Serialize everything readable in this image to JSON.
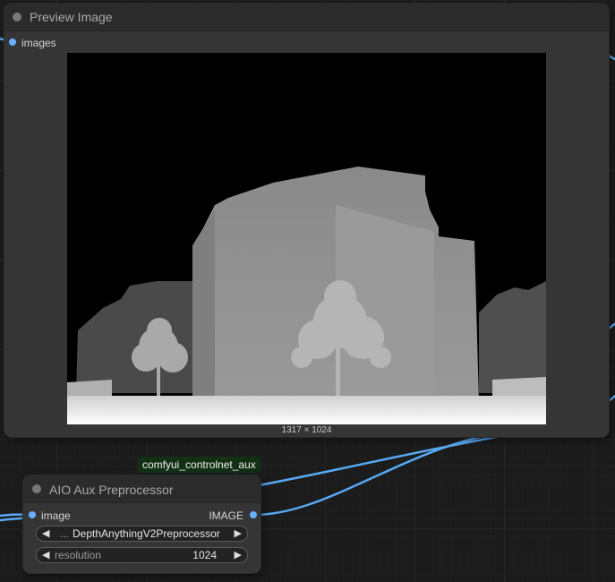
{
  "preview_node": {
    "title": "Preview Image",
    "input_label": "images",
    "image_dimensions": "1317 × 1024",
    "image_alt": "depth map of a building with trees"
  },
  "badge": {
    "label": "comfyui_controlnet_aux"
  },
  "aux_node": {
    "title": "AIO Aux Preprocessor",
    "input_label": "image",
    "output_label": "IMAGE",
    "preprocessor_prefix": "...",
    "preprocessor_value": "DepthAnythingV2Preprocessor",
    "resolution_label": "resolution",
    "resolution_value": "1024"
  },
  "colors": {
    "link": "#57a9f5",
    "slot": "#66b2ff",
    "node_body": "#353535",
    "node_title": "#2b2b2b",
    "canvas": "#1b1b1b"
  }
}
